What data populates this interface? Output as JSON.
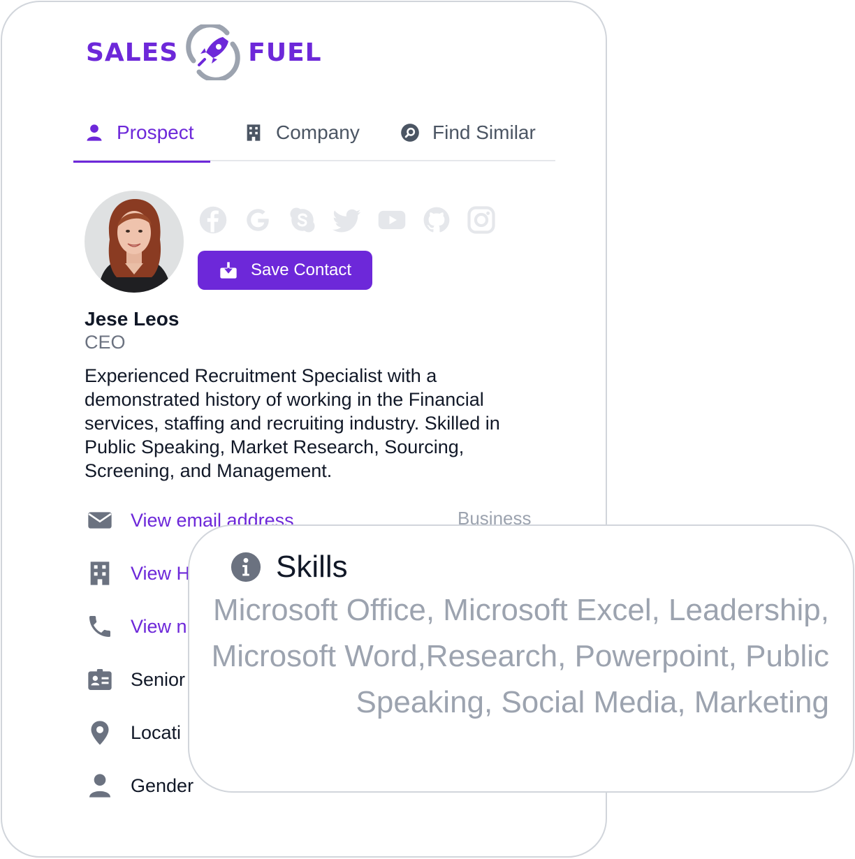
{
  "brand": {
    "left_word": "SALES",
    "right_word": "FUEL",
    "color": "#6d28d9"
  },
  "tabs": [
    {
      "label": "Prospect",
      "icon": "user-icon",
      "active": true
    },
    {
      "label": "Company",
      "icon": "building-icon",
      "active": false
    },
    {
      "label": "Find Similar",
      "icon": "search-circle-icon",
      "active": false
    }
  ],
  "profile": {
    "name": "Jese Leos",
    "title": "CEO",
    "bio": "Experienced Recruitment Specialist with a demonstrated history of working in the Financial services, staffing and recruiting industry. Skilled in Public Speaking, Market Research, Sourcing, Screening, and Management.",
    "socials": [
      "facebook-icon",
      "google-icon",
      "skype-icon",
      "twitter-icon",
      "youtube-icon",
      "github-icon",
      "instagram-icon"
    ],
    "save_label": "Save Contact"
  },
  "info": {
    "email": {
      "label": "View email address",
      "badge": "Business",
      "icon": "mail-icon"
    },
    "company": {
      "label": "View H",
      "icon": "building-icon"
    },
    "phone": {
      "label": "View n",
      "icon": "phone-icon"
    },
    "seniority": {
      "label": "Senior",
      "icon": "id-card-icon"
    },
    "location": {
      "label": "Locati",
      "icon": "map-pin-icon"
    },
    "gender": {
      "label": "Gender",
      "icon": "user-icon"
    }
  },
  "skills": {
    "title": "Skills",
    "icon": "info-icon",
    "text": "Microsoft Office, Microsoft Excel, Leadership, Microsoft Word,Research, Powerpoint, Public Speaking, Social Media, Marketing"
  },
  "colors": {
    "accent": "#6d28d9",
    "muted": "#9ca3af",
    "icon_gray": "#6b7280",
    "border": "#d1d5db"
  }
}
